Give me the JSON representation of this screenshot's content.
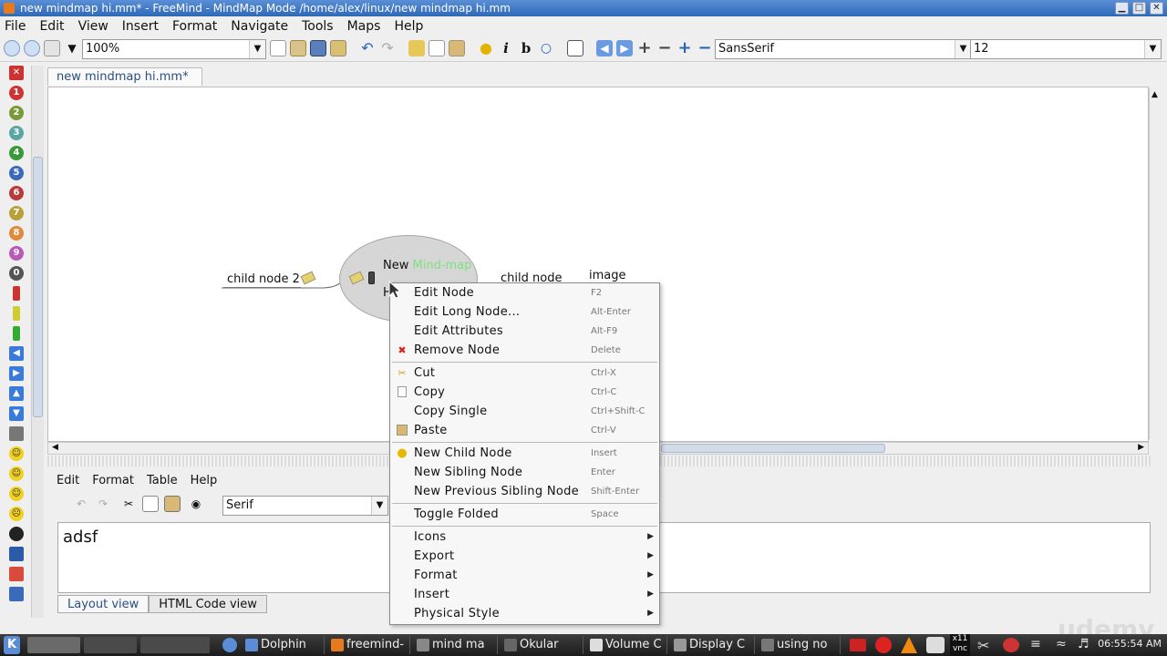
{
  "window": {
    "title": "new mindmap hi.mm* - FreeMind - MindMap Mode /home/alex/linux/new mindmap hi.mm",
    "minimize": "▁",
    "maximize": "□",
    "close": "✕"
  },
  "menubar": [
    "File",
    "Edit",
    "View",
    "Insert",
    "Format",
    "Navigate",
    "Tools",
    "Maps",
    "Help"
  ],
  "toolbar": {
    "zoom": "100%",
    "font": "SansSerif",
    "font_size": "12"
  },
  "tab": {
    "label": "new mindmap hi.mm*"
  },
  "map": {
    "root_text_a": "New",
    "root_text_b": "Mind-map",
    "left_child": "child node 2",
    "right_child": "child node",
    "image_node": "image",
    "root_overflow": "H"
  },
  "editor": {
    "menu": [
      "Edit",
      "Format",
      "Table",
      "Help"
    ],
    "font": "Serif",
    "text": "adsf",
    "view_tabs": [
      "Layout view",
      "HTML Code view"
    ]
  },
  "context_menu": [
    {
      "label": "Edit Node",
      "shortcut": "F2"
    },
    {
      "label": "Edit Long Node...",
      "shortcut": "Alt-Enter"
    },
    {
      "label": "Edit Attributes",
      "shortcut": "Alt-F9"
    },
    {
      "label": "Remove Node",
      "shortcut": "Delete",
      "icon": "remove-icon"
    },
    {
      "label": "Cut",
      "shortcut": "Ctrl-X",
      "icon": "cut-icon"
    },
    {
      "label": "Copy",
      "shortcut": "Ctrl-C",
      "icon": "copy-icon"
    },
    {
      "label": "Copy Single",
      "shortcut": "Ctrl+Shift-C"
    },
    {
      "label": "Paste",
      "shortcut": "Ctrl-V",
      "icon": "paste-icon"
    },
    {
      "label": "New Child Node",
      "shortcut": "Insert",
      "icon": "lightbulb-icon"
    },
    {
      "label": "New Sibling Node",
      "shortcut": "Enter"
    },
    {
      "label": "New Previous Sibling Node",
      "shortcut": "Shift-Enter"
    },
    {
      "label": "Toggle Folded",
      "shortcut": "Space"
    },
    {
      "label": "Icons",
      "submenu": true
    },
    {
      "label": "Export",
      "submenu": true
    },
    {
      "label": "Format",
      "submenu": true
    },
    {
      "label": "Insert",
      "submenu": true
    },
    {
      "label": "Physical Style",
      "submenu": true
    }
  ],
  "taskbar": {
    "tasks": [
      "Dolphin",
      "freemind-",
      "mind ma",
      "Okular",
      "Volume C",
      "Display C",
      "using no"
    ],
    "clock": "06:55:54 AM",
    "vnc_label": "x11 vnc"
  },
  "watermark": "udemy",
  "left_icons": [
    "1",
    "2",
    "3",
    "4",
    "5",
    "6",
    "7",
    "8",
    "9",
    "0"
  ]
}
